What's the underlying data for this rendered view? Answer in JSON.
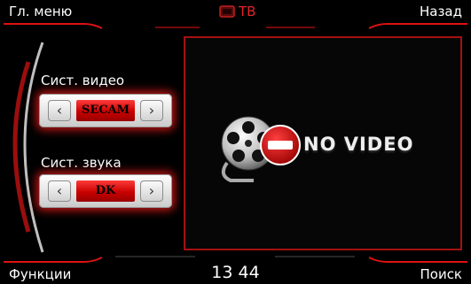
{
  "header": {
    "main_menu_label": "Гл. меню",
    "title": "ТВ",
    "title_icon": "tv-icon",
    "back_label": "Назад"
  },
  "settings": {
    "video": {
      "label": "Сист. видео",
      "value": "SECAM",
      "prev_icon": "chevron-left-icon",
      "next_icon": "chevron-right-icon"
    },
    "audio": {
      "label": "Сист. звука",
      "value": "DK",
      "prev_icon": "chevron-left-icon",
      "next_icon": "chevron-right-icon"
    }
  },
  "video_panel": {
    "status_text": "NO VIDEO",
    "icon": "film-reel-no-entry-icon"
  },
  "footer": {
    "functions_label": "Функции",
    "clock": "13 44",
    "search_label": "Поиск"
  },
  "colors": {
    "accent": "#e2232b",
    "border": "#a51010",
    "background": "#000000"
  }
}
